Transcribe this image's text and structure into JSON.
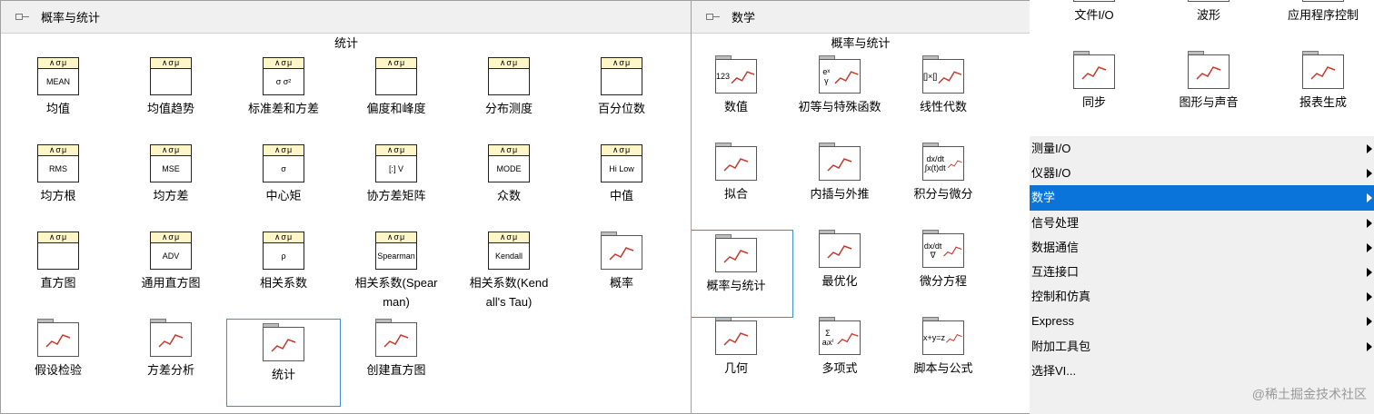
{
  "left_panel": {
    "title": "概率与统计",
    "group": "统计",
    "items": [
      {
        "label": "均值",
        "icon": "mean-icon",
        "text": "MEAN"
      },
      {
        "label": "均值趋势",
        "icon": "mean-trend-icon",
        "text": ""
      },
      {
        "label": "标准差和方差",
        "icon": "std-variance-icon",
        "text": "σ σ²"
      },
      {
        "label": "偏度和峰度",
        "icon": "skew-kurtosis-icon",
        "text": ""
      },
      {
        "label": "分布测度",
        "icon": "distribution-icon",
        "text": ""
      },
      {
        "label": "百分位数",
        "icon": "percentile-icon",
        "text": ""
      },
      {
        "label": "均方根",
        "icon": "rms-icon",
        "text": "RMS"
      },
      {
        "label": "均方差",
        "icon": "mse-icon",
        "text": "MSE"
      },
      {
        "label": "中心矩",
        "icon": "moment-icon",
        "text": "σ"
      },
      {
        "label": "协方差矩阵",
        "icon": "covariance-icon",
        "text": "[:] V"
      },
      {
        "label": "众数",
        "icon": "mode-icon",
        "text": "MODE"
      },
      {
        "label": "中值",
        "icon": "median-icon",
        "text": "Hi Low"
      },
      {
        "label": "直方图",
        "icon": "histogram-icon",
        "text": ""
      },
      {
        "label": "通用直方图",
        "icon": "general-histogram-icon",
        "text": "ADV"
      },
      {
        "label": "相关系数",
        "icon": "correlation-icon",
        "text": "ρ"
      },
      {
        "label": "相关系数(Spear\nman)",
        "icon": "spearman-icon",
        "text": "Spearman"
      },
      {
        "label": "相关系数(Kend\nall's Tau)",
        "icon": "kendall-icon",
        "text": "Kendall"
      },
      {
        "label": "概率",
        "icon": "probability-folder-icon",
        "text": ""
      },
      {
        "label": "假设检验",
        "icon": "hypothesis-folder-icon",
        "text": ""
      },
      {
        "label": "方差分析",
        "icon": "anova-folder-icon",
        "text": ""
      },
      {
        "label": "统计",
        "icon": "statistics-express-icon",
        "text": ""
      },
      {
        "label": "创建直方图",
        "icon": "create-histogram-icon",
        "text": ""
      }
    ]
  },
  "mid_panel": {
    "title": "数学",
    "group": "概率与统计",
    "items": [
      {
        "label": "数值",
        "icon": "numeric-folder-icon",
        "text": "123"
      },
      {
        "label": "初等与特殊函数",
        "icon": "elementary-functions-icon",
        "text": "eˣ γ"
      },
      {
        "label": "线性代数",
        "icon": "linear-algebra-icon",
        "text": "[]×[]"
      },
      {
        "label": "拟合",
        "icon": "fitting-icon",
        "text": ""
      },
      {
        "label": "内插与外推",
        "icon": "interpolation-icon",
        "text": ""
      },
      {
        "label": "积分与微分",
        "icon": "integration-icon",
        "text": "dx/dt ∫x(t)dt"
      },
      {
        "label": "概率与统计",
        "icon": "prob-stat-icon",
        "text": ""
      },
      {
        "label": "最优化",
        "icon": "optimization-icon",
        "text": ""
      },
      {
        "label": "微分方程",
        "icon": "diff-equations-icon",
        "text": "dx/dt ∇"
      },
      {
        "label": "几何",
        "icon": "geometry-icon",
        "text": ""
      },
      {
        "label": "多项式",
        "icon": "polynomial-icon",
        "text": "Σ aᵢxⁱ"
      },
      {
        "label": "脚本与公式",
        "icon": "script-formula-icon",
        "text": "x+y=z"
      }
    ]
  },
  "right_panel": {
    "items": [
      {
        "label": "文件I/O",
        "icon": "file-io-icon"
      },
      {
        "label": "波形",
        "icon": "waveform-icon"
      },
      {
        "label": "应用程序控制",
        "icon": "app-control-icon"
      },
      {
        "label": "同步",
        "icon": "sync-icon"
      },
      {
        "label": "图形与声音",
        "icon": "graphics-sound-icon"
      },
      {
        "label": "报表生成",
        "icon": "report-icon"
      }
    ],
    "menu": [
      {
        "label": "测量I/O",
        "arrow": true
      },
      {
        "label": "仪器I/O",
        "arrow": true
      },
      {
        "label": "数学",
        "arrow": true,
        "active": true
      },
      {
        "label": "信号处理",
        "arrow": true
      },
      {
        "label": "数据通信",
        "arrow": true
      },
      {
        "label": "互连接口",
        "arrow": true
      },
      {
        "label": "控制和仿真",
        "arrow": true
      },
      {
        "label": "Express",
        "arrow": true
      },
      {
        "label": "附加工具包",
        "arrow": true
      },
      {
        "label": "选择VI...",
        "arrow": false
      }
    ],
    "watermark": "@稀土掘金技术社区"
  }
}
